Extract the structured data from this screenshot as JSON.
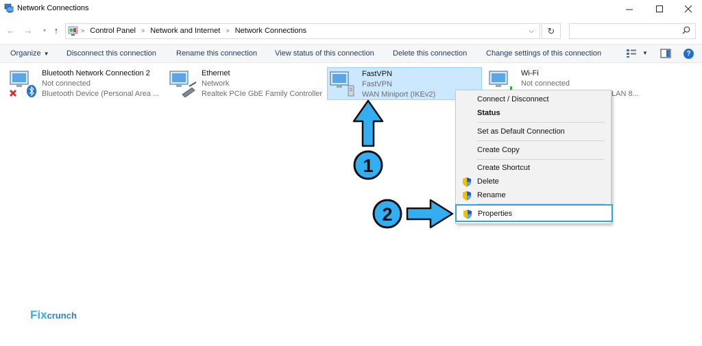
{
  "window": {
    "title": "Network Connections"
  },
  "address": {
    "crumbs": [
      "Control Panel",
      "Network and Internet",
      "Network Connections"
    ],
    "search_placeholder": ""
  },
  "commands": {
    "organize": "Organize",
    "disconnect": "Disconnect this connection",
    "rename": "Rename this connection",
    "view_status": "View status of this connection",
    "delete": "Delete this connection",
    "change_settings": "Change settings of this connection"
  },
  "connections": [
    {
      "name": "Bluetooth Network Connection 2",
      "status": "Not connected",
      "device": "Bluetooth Device (Personal Area ..."
    },
    {
      "name": "Ethernet",
      "status": "Network",
      "device": "Realtek PCIe GbE Family Controller"
    },
    {
      "name": "FastVPN",
      "status": "FastVPN",
      "device": "WAN Miniport (IKEv2)"
    },
    {
      "name": "Wi-Fi",
      "status": "Not connected",
      "device": "LAN 8..."
    }
  ],
  "context_menu": {
    "connect": "Connect / Disconnect",
    "status": "Status",
    "set_default": "Set as Default Connection",
    "create_copy": "Create Copy",
    "create_shortcut": "Create Shortcut",
    "delete": "Delete",
    "rename": "Rename",
    "properties": "Properties"
  },
  "annotations": {
    "step1": "1",
    "step2": "2"
  },
  "watermark": {
    "part1": "Fix",
    "part2": "crunch"
  },
  "colors": {
    "accent": "#2fa4e7",
    "selection": "#cce8ff",
    "arrow_fill": "#33aef0"
  }
}
